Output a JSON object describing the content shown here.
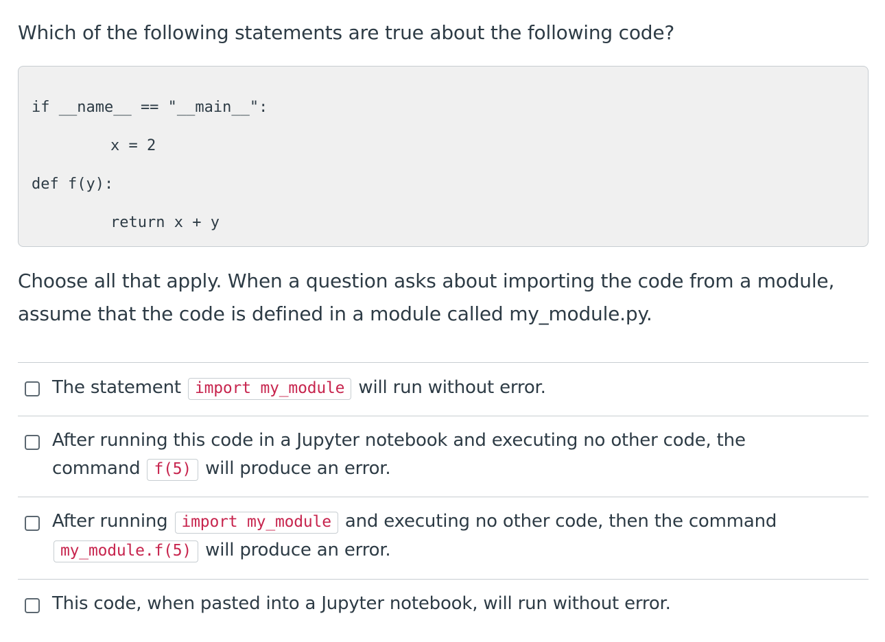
{
  "question": {
    "title": "Which of the following statements are true about the following code?"
  },
  "code": {
    "line1": "if __name__ == \"__main__\":",
    "line2": "x = 2",
    "line3": "def f(y):",
    "line4": "return x + y"
  },
  "instructions": {
    "text": "Choose all that apply. When a question asks about importing the code from a module, assume that the code is defined in a module called my_module.py."
  },
  "answers": [
    {
      "before": "The statement ",
      "code": "import my_module",
      "after": " will run without error.",
      "checked": false
    },
    {
      "before": "After running this code in a Jupyter notebook and executing no other code, the command ",
      "code": "f(5)",
      "after": " will produce an error.",
      "checked": false
    },
    {
      "before": "After running ",
      "code": "import my_module",
      "middle": " and executing no other code, then the command ",
      "code2": "my_module.f(5)",
      "after": " will produce an error.",
      "checked": false
    },
    {
      "before": "This code, when pasted into a Jupyter notebook, will run without error.",
      "checked": false
    }
  ],
  "colors": {
    "text": "#2d3b45",
    "code_inline": "#c7254e",
    "code_block_bg": "#f0f0f0",
    "border": "#c7cdd1"
  }
}
